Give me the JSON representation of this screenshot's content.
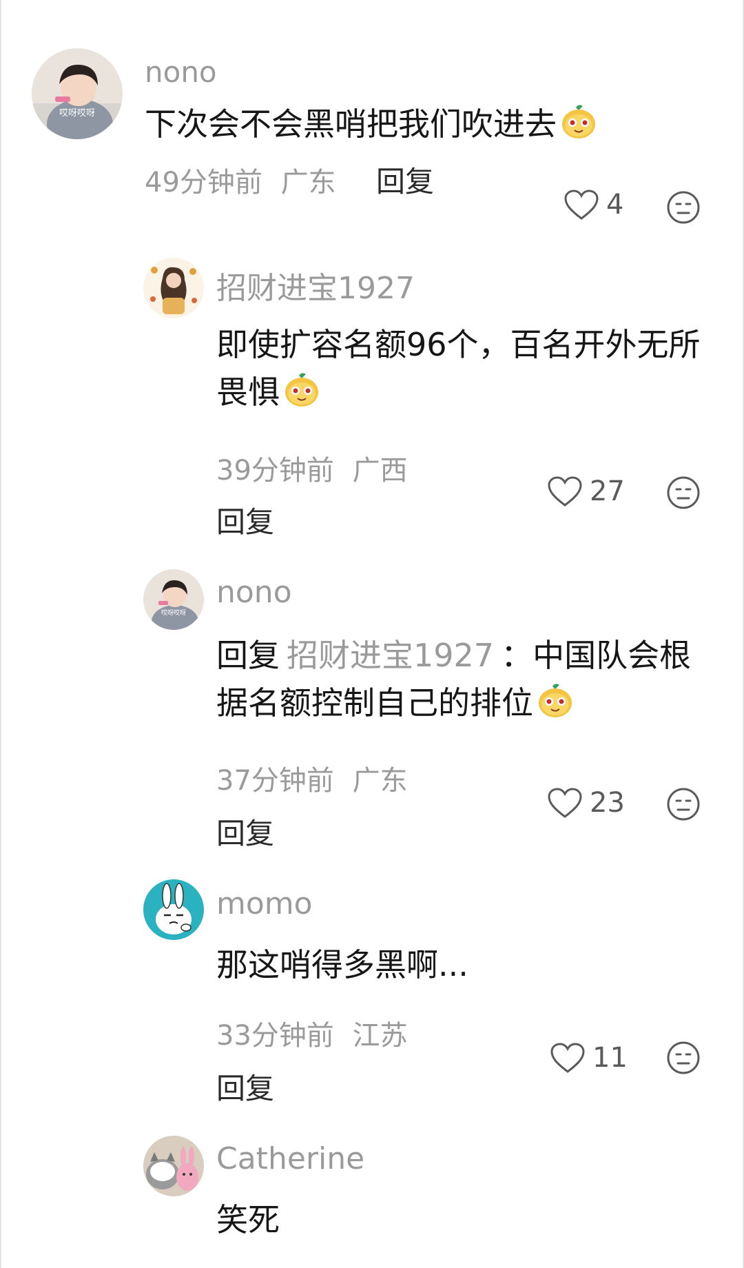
{
  "comments": [
    {
      "username": "nono",
      "text": "下次会不会黑哨把我们吹进去",
      "time": "49分钟前",
      "location": "广东",
      "reply_label": "回复",
      "likes": "4",
      "avatar_caption": "哎呀哎呀",
      "emoji": "pumpkin-emoji"
    },
    {
      "username": "招财进宝1927",
      "text": "即使扩容名额96个，百名开外无所畏惧",
      "time": "39分钟前",
      "location": "广西",
      "reply_label": "回复",
      "likes": "27",
      "emoji": "pumpkin-emoji"
    },
    {
      "username": "nono",
      "reply_prefix": "回复",
      "mention": "招财进宝1927",
      "text": "：中国队会根据名额控制自己的排位",
      "time": "37分钟前",
      "location": "广东",
      "reply_label": "回复",
      "likes": "23",
      "avatar_caption": "哎呀哎呀",
      "emoji": "pumpkin-emoji"
    },
    {
      "username": "momo",
      "text": "那这哨得多黑啊...",
      "time": "33分钟前",
      "location": "江苏",
      "reply_label": "回复",
      "likes": "11"
    },
    {
      "username": "Catherine",
      "text": "笑死"
    }
  ],
  "colors": {
    "meta": "#9a9a9a",
    "text": "#161616",
    "icon": "#5a5a5a"
  }
}
